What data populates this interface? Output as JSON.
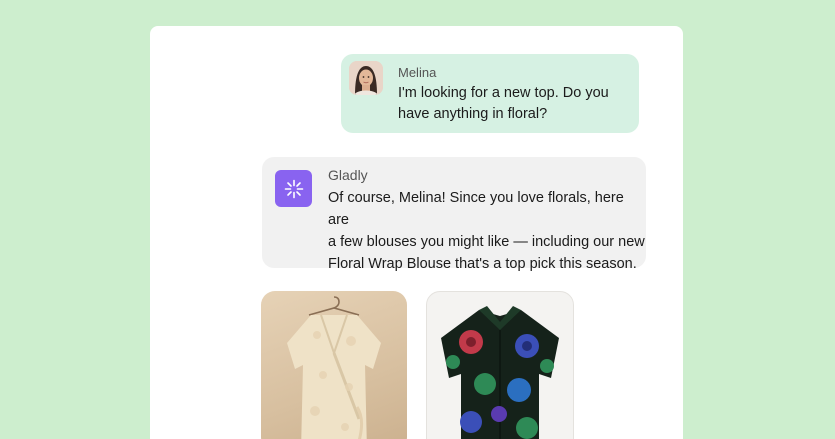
{
  "user_message": {
    "sender": "Melina",
    "lines": [
      "I'm looking for a new top. Do you",
      "have anything in floral?"
    ]
  },
  "bot_message": {
    "sender": "Gladly",
    "lines": [
      "Of course, Melina! Since you love florals, here are",
      "a few blouses you might like — including our new",
      "Floral Wrap Blouse that's a top pick this season."
    ]
  },
  "products": [
    {
      "icon": "floral-wrap-blouse-image"
    },
    {
      "icon": "floral-button-shirt-image"
    }
  ],
  "colors": {
    "background": "#cdeece",
    "user_bubble": "#d6f1e3",
    "bot_bubble": "#f1f1f1",
    "bot_icon": "#8963f0"
  }
}
